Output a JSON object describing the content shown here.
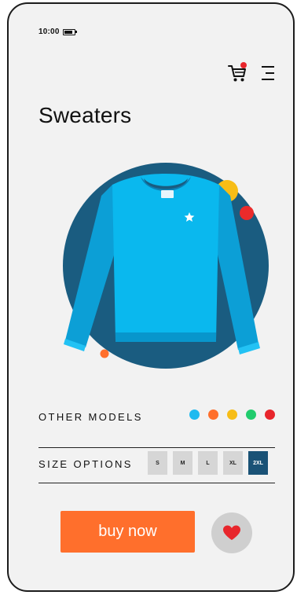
{
  "status_bar": {
    "time": "10:00"
  },
  "header": {
    "cart_icon": "cart-icon",
    "menu_icon": "menu-icon",
    "cart_badge_color": "#e8262c"
  },
  "page": {
    "title": "Sweaters"
  },
  "product": {
    "image": "sweater-image",
    "colors": {
      "circle": "#1a5c80",
      "sweater": "#0ab0e6",
      "accent_yellow": "#f7bd16",
      "accent_red": "#ea2b2b",
      "accent_orange": "#ff6f2c"
    }
  },
  "other_models": {
    "label": "OTHER MODELS",
    "swatches": [
      "#1ebaf0",
      "#ff6f2c",
      "#f7bd16",
      "#21cc6d",
      "#e8262c"
    ]
  },
  "size_options": {
    "label": "SIZE OPTIONS",
    "sizes": [
      "S",
      "M",
      "L",
      "XL",
      "2XL"
    ],
    "selected": "2XL"
  },
  "actions": {
    "buy_label": "buy now",
    "favorite_icon": "heart-icon"
  }
}
